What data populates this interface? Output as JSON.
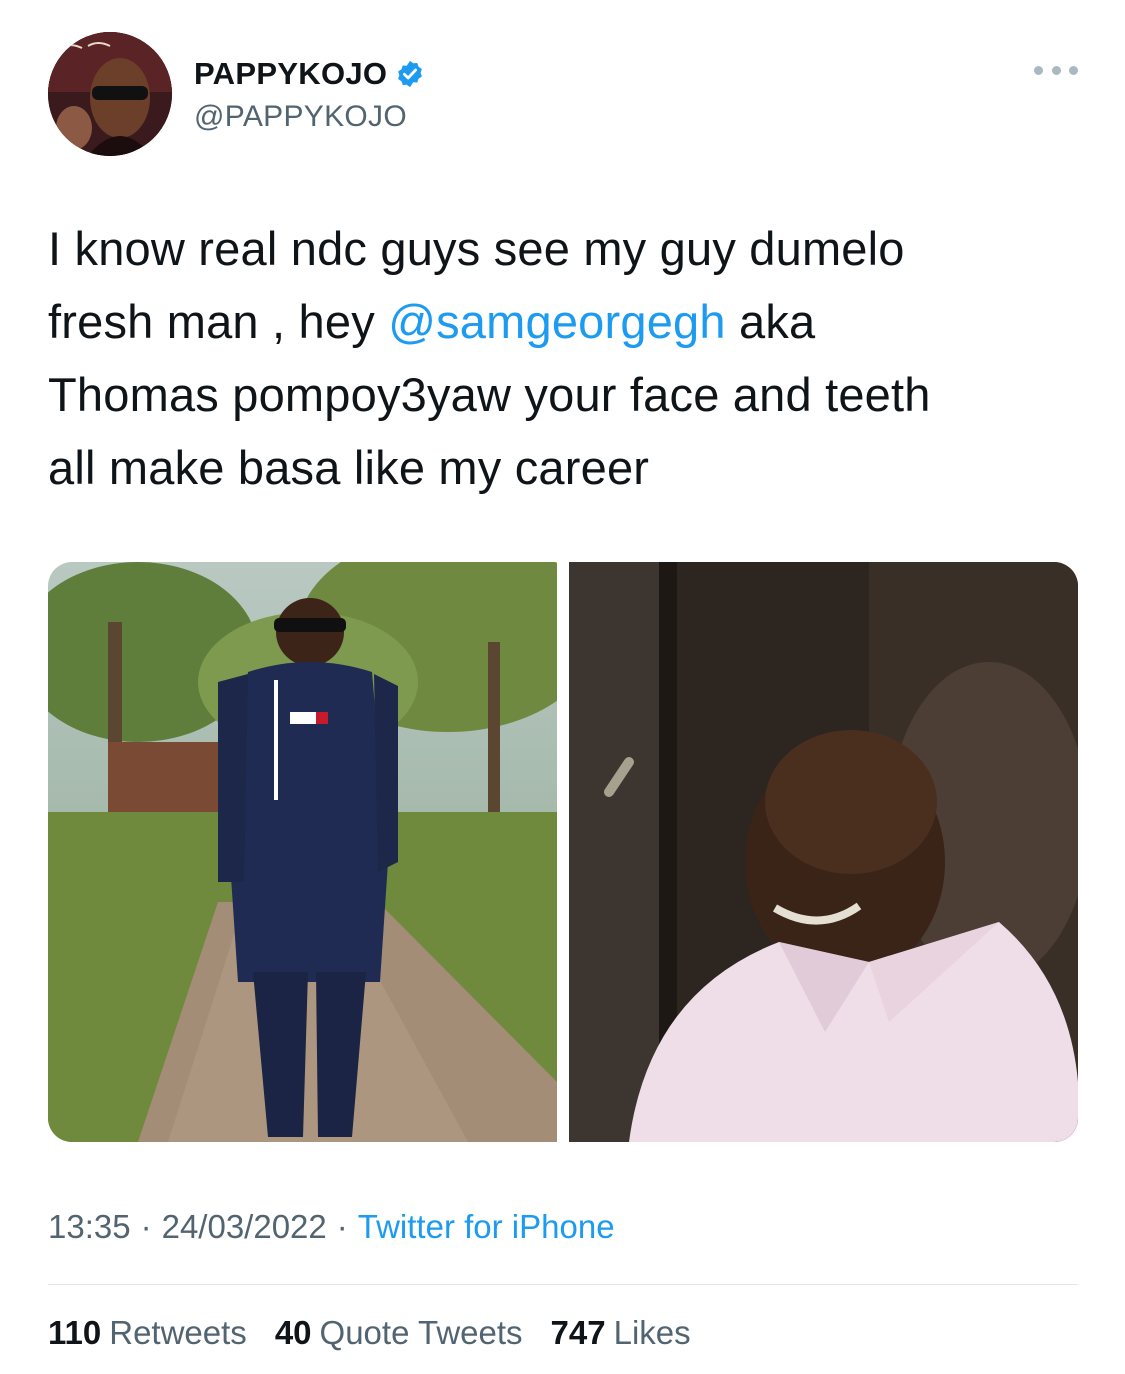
{
  "tweet": {
    "author": {
      "display_name": "PAPPYKOJO",
      "handle": "@PAPPYKOJO",
      "verified": true,
      "avatar_icon": "profile-photo"
    },
    "more_icon": "more-options-icon",
    "text": {
      "line1": "I know real ndc guys see my guy dumelo",
      "line2_before": "fresh man , hey ",
      "mention": "@samgeorgegh",
      "line2_after": " aka",
      "line3": "Thomas pompoy3yaw your face and teeth",
      "line4": "all make basa like my career"
    },
    "media": [
      {
        "kind": "photo",
        "icon": "photo-man-in-navy-outfit"
      },
      {
        "kind": "photo",
        "icon": "photo-smiling-man-pink-shirt"
      }
    ],
    "meta": {
      "time": "13:35",
      "date": "24/03/2022",
      "separator": "·",
      "source": "Twitter for iPhone"
    },
    "stats": {
      "retweets_count": "110",
      "retweets_label": "Retweets",
      "quotes_count": "40",
      "quotes_label": "Quote Tweets",
      "likes_count": "747",
      "likes_label": "Likes"
    },
    "colors": {
      "text": "#0f1419",
      "secondary": "#536471",
      "accent": "#1d9bf0"
    }
  }
}
